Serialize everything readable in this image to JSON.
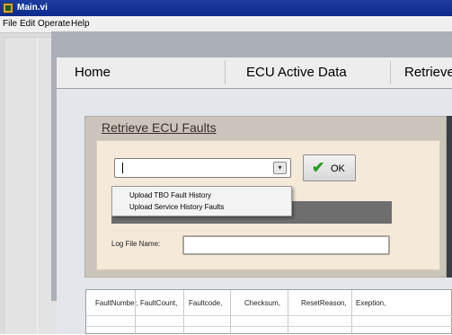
{
  "window": {
    "title": "Main.vi"
  },
  "menu": {
    "items": [
      "File",
      "Edit",
      "Operate",
      "Help"
    ]
  },
  "tabs": [
    "Home",
    "ECU Active Data",
    "Retrieve"
  ],
  "faults": {
    "title": "Retrieve ECU Faults",
    "combo_value": "",
    "dropdown_options": [
      "Upload TBO Fault History",
      "Upload Service History Faults"
    ],
    "ok_label": "OK",
    "log_file_label": "Log File Name:",
    "log_file_value": ""
  },
  "table": {
    "headers": [
      "FaultNumber,",
      "FaultCount,",
      "Faultcode,",
      "Checksum,",
      "ResetReason,",
      "Exeption,"
    ]
  },
  "icons": {
    "app": "labview-vi-icon",
    "ok": "green-check-icon",
    "combo_arrow": "dropdown-arrow-icon"
  },
  "colors": {
    "titlebar": "#0a2a8c",
    "panel_frame": "#cbc4ba",
    "panel_inner": "#f5e9da",
    "ok_check": "#2a9a25"
  }
}
